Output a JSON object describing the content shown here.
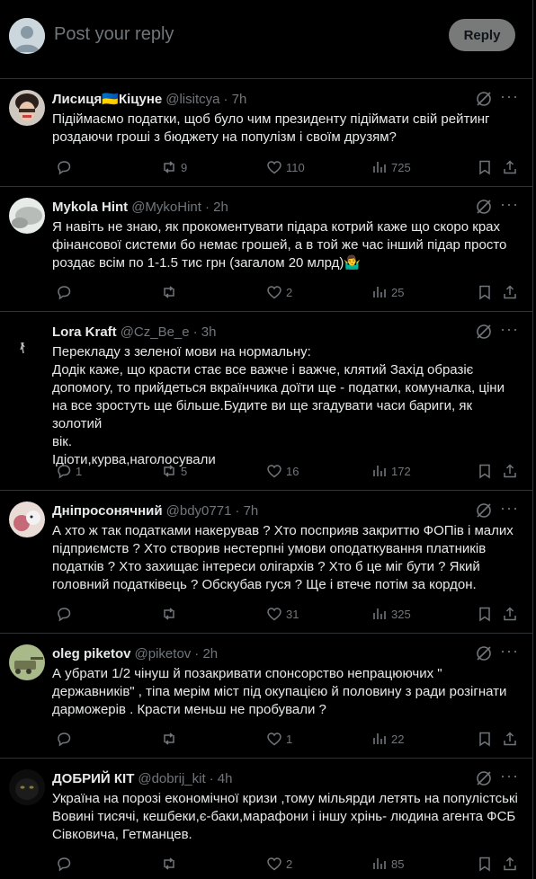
{
  "compose": {
    "placeholder": "Post your reply",
    "reply_label": "Reply"
  },
  "colors": {
    "background": "#000000",
    "text": "#e7e9ea",
    "muted": "#71767b",
    "divider": "#2f3336",
    "reply_button": "#787a7a"
  },
  "tweets": [
    {
      "name": "Лисиця🇺🇦Кіцуне",
      "handle": "@lisitcya",
      "time": "· 7h",
      "text": "Підіймаємо податки, щоб було чим президенту підіймати свій рейтинг\nроздаючи гроші з бюджету на популізм і своїм друзям?",
      "replies": "",
      "reposts": "9",
      "likes": "110",
      "views": "725"
    },
    {
      "name": "Mykola Hint",
      "handle": "@MykoHint",
      "time": "· 2h",
      "text": "Я навіть не знаю, як прокоментувати підара котрий каже що скоро крах\nфінансової системи бо немає грошей, а в той же час інший підар просто\nроздає всім по 1-1.5 тис грн (загалом 20 млрд)🤷‍♂️",
      "replies": "",
      "reposts": "",
      "likes": "2",
      "views": "25"
    },
    {
      "name": "Lora Kraft",
      "handle": "@Cz_Be_e",
      "time": "· 3h",
      "text": "Перекладу з зеленої мови на нормальну:\nДодік каже, що красти стає все важче і важче, клятий Захід образіє\nдопомогу, то прийдеться вкраїнчика доїти ще - податки, комуналка, ціни\nна все зростуть ще більше.Будите ви ще згадувати часи бариги, як золотий\nвік.\nІдіоти,курва,наголосували",
      "replies": "1",
      "reposts": "5",
      "likes": "16",
      "views": "172"
    },
    {
      "name": "Дніпросонячний",
      "handle": "@bdy0771",
      "time": "· 7h",
      "text": "А хто ж так податками накерував ? Хто посприяв закриттю ФОПів і малих\nпідприємств ? Хто створив нестерпні умови оподаткування платників\nподатків ? Хто захищає інтереси олігархів ? Хто б це міг бути ? Який\nголовний податківець ? Обскубав гуся ? Ще і втече потім за кордон.",
      "replies": "",
      "reposts": "",
      "likes": "31",
      "views": "325"
    },
    {
      "name": "oleg piketov",
      "handle": "@piketov",
      "time": "· 2h",
      "text": "А убрати 1/2 чінуш й позакривати спонсорство непрацюючих \"\nдержавників\" , тіпа мерім міст під окупацією й половину з ради розігнати\nдарможерів . Красти меньш не пробували ?",
      "replies": "",
      "reposts": "",
      "likes": "1",
      "views": "22"
    },
    {
      "name": "ДОБРИЙ КІТ",
      "handle": "@dobrij_kit",
      "time": "· 4h",
      "text": "Україна на порозі економічної кризи ,тому мільярди летять на популістські\nВовині тисячі, кешбеки,є-баки,марафони і іншу хрінь- людина агента ФСБ\nСівковича, Гетманцев.",
      "replies": "",
      "reposts": "",
      "likes": "2",
      "views": "85"
    }
  ]
}
